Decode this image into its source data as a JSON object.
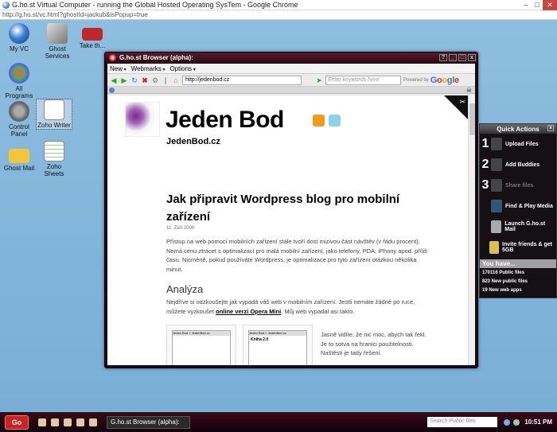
{
  "chrome": {
    "title": "G.ho.st Virtual Computer - running the Global Hosted Operating SysTem - Google Chrome",
    "url": "http://g.ho.st/vc.html?ghostId=jackub&isPopup=true"
  },
  "desktop_icons": [
    {
      "label": "My VC"
    },
    {
      "label": "Ghost Services"
    },
    {
      "label": "Take th..."
    },
    {
      "label": "All Programs"
    },
    {
      "label": "Control Panel"
    },
    {
      "label": "Zoho Writer"
    },
    {
      "label": "Ghost Mail"
    },
    {
      "label": "Zoho Sheets"
    }
  ],
  "browser": {
    "title": "G.ho.st Browser (alpha):",
    "menu": [
      "New",
      "Webmarks",
      "Options"
    ],
    "url": "http://jedenbod.cz",
    "search_placeholder": "Enter keywords here",
    "powered_by": "Powered by",
    "google": "Google"
  },
  "page": {
    "site_title": "Jeden Bod",
    "site_sub": "JedenBod.cz",
    "post_title": "Jak připravit Wordpress blog pro mobilní zařízení",
    "post_date": "11. Září 2009",
    "paragraph1": "Přístup na web pomocí mobilních zařízení stále tvoří dost mizivou část návštěv (v řádu procent). Nemá cenu ztrácet s optimalizací pro malá mobilní zařízení, jako telefony, PDA, iPhony apod. příliš času. Nicméně, pokud používáte Wordpress, je optimalizace pro tyto zařízení otázkou několika minut.",
    "heading2": "Analýza",
    "paragraph2_a": "Nejdříve si odzkoušejte jak vypadá váš web v mobilním zařízení. Jestli nemáte žádné po ruce, můžete vyzkoušet ",
    "paragraph2_link": "online verzi Opera Mini",
    "paragraph2_b": ". Můj web vypadal asi takto.",
    "thumb1_head": "Jeden Bod » JedenBod.cz",
    "thumb2_head": "Jeden Bod » JedenBod.cz",
    "thumb2_title": "Kniha 2.0",
    "side_text": "Jasně vidíte, že nic moc, abych tak řekl. Je to sotva na hranici použitelnosti. Naštěstí je tady řešení."
  },
  "quick_actions": {
    "title": "Quick Actions",
    "items": [
      {
        "num": "1",
        "label": "Upload Files"
      },
      {
        "num": "2",
        "label": "Add Buddies"
      },
      {
        "num": "3",
        "label": "Share files"
      },
      {
        "num": "",
        "label": "Find & Play Media"
      },
      {
        "num": "",
        "label": "Launch G.ho.st Mail"
      },
      {
        "num": "",
        "label": "Invite friends & get 5GB"
      }
    ],
    "you_have": "You have...",
    "stats": [
      "170116 Public files",
      "823 New public files",
      "19 New web apps"
    ]
  },
  "taskbar": {
    "start": "Go",
    "task": "G.ho.st Browser (alpha):",
    "search_placeholder": "Search Public files",
    "clock": "10:51 PM"
  }
}
